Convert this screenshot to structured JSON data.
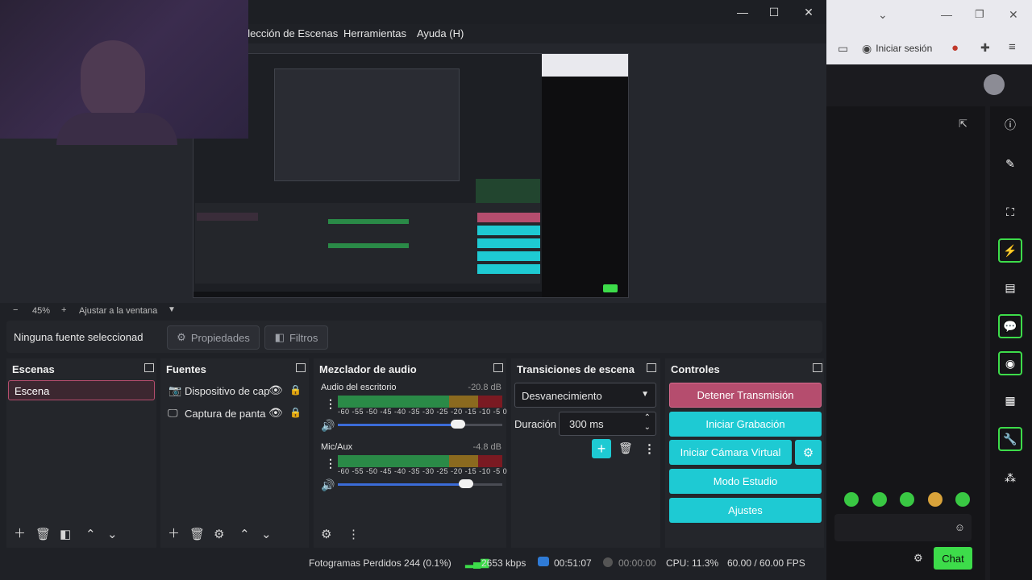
{
  "menu": {
    "items": [
      "olección de Escenas",
      "Herramientas",
      "Ayuda (H)"
    ]
  },
  "window_controls": {
    "minimize": "—",
    "maximize": "☐",
    "close": "✕"
  },
  "zoom": {
    "minus": "−",
    "level": "45%",
    "plus": "+",
    "fit_label": "Ajustar a la ventana",
    "dropdown": "▼"
  },
  "sourcebar": {
    "no_source": "Ninguna fuente seleccionad",
    "properties_label": "Propiedades",
    "filters_label": "Filtros"
  },
  "scenes": {
    "title": "Escenas",
    "items": [
      {
        "label": "Escena",
        "selected": true
      }
    ]
  },
  "sources": {
    "title": "Fuentes",
    "items": [
      {
        "label": "Dispositivo de cap"
      },
      {
        "label": "Captura de panta"
      }
    ]
  },
  "mixer": {
    "title": "Mezclador de audio",
    "channels": [
      {
        "name": "Audio del escritorio",
        "db": "-20.8 dB",
        "volume_percent": 73
      },
      {
        "name": "Mic/Aux",
        "db": "-4.8 dB",
        "volume_percent": 78
      }
    ],
    "tick_labels": "-60 -55 -50 -45 -40 -35 -30 -25 -20 -15 -10 -5 0"
  },
  "transitions": {
    "title": "Transiciones de escena",
    "selected": "Desvanecimiento",
    "duration_label": "Duración",
    "duration_value": "300 ms"
  },
  "controls": {
    "title": "Controles",
    "stop_stream": "Detener Transmisión",
    "start_recording": "Iniciar Grabación",
    "start_virtual_cam": "Iniciar Cámara Virtual",
    "studio_mode": "Modo Estudio",
    "settings": "Ajustes"
  },
  "status": {
    "dropped_frames": "Fotogramas Perdidos 244 (0.1%)",
    "bitrate": "2653 kbps",
    "stream_time": "00:51:07",
    "record_time": "00:00:00",
    "cpu": "CPU: 11.3%",
    "fps": "60.00 / 60.00 FPS"
  },
  "browser": {
    "signin_label": "Iniciar sesión",
    "chat_button": "Chat"
  },
  "colors": {
    "accent_teal": "#1ecad3",
    "stop_pink": "#b54d6e",
    "green_rail": "#3ddc4a"
  }
}
